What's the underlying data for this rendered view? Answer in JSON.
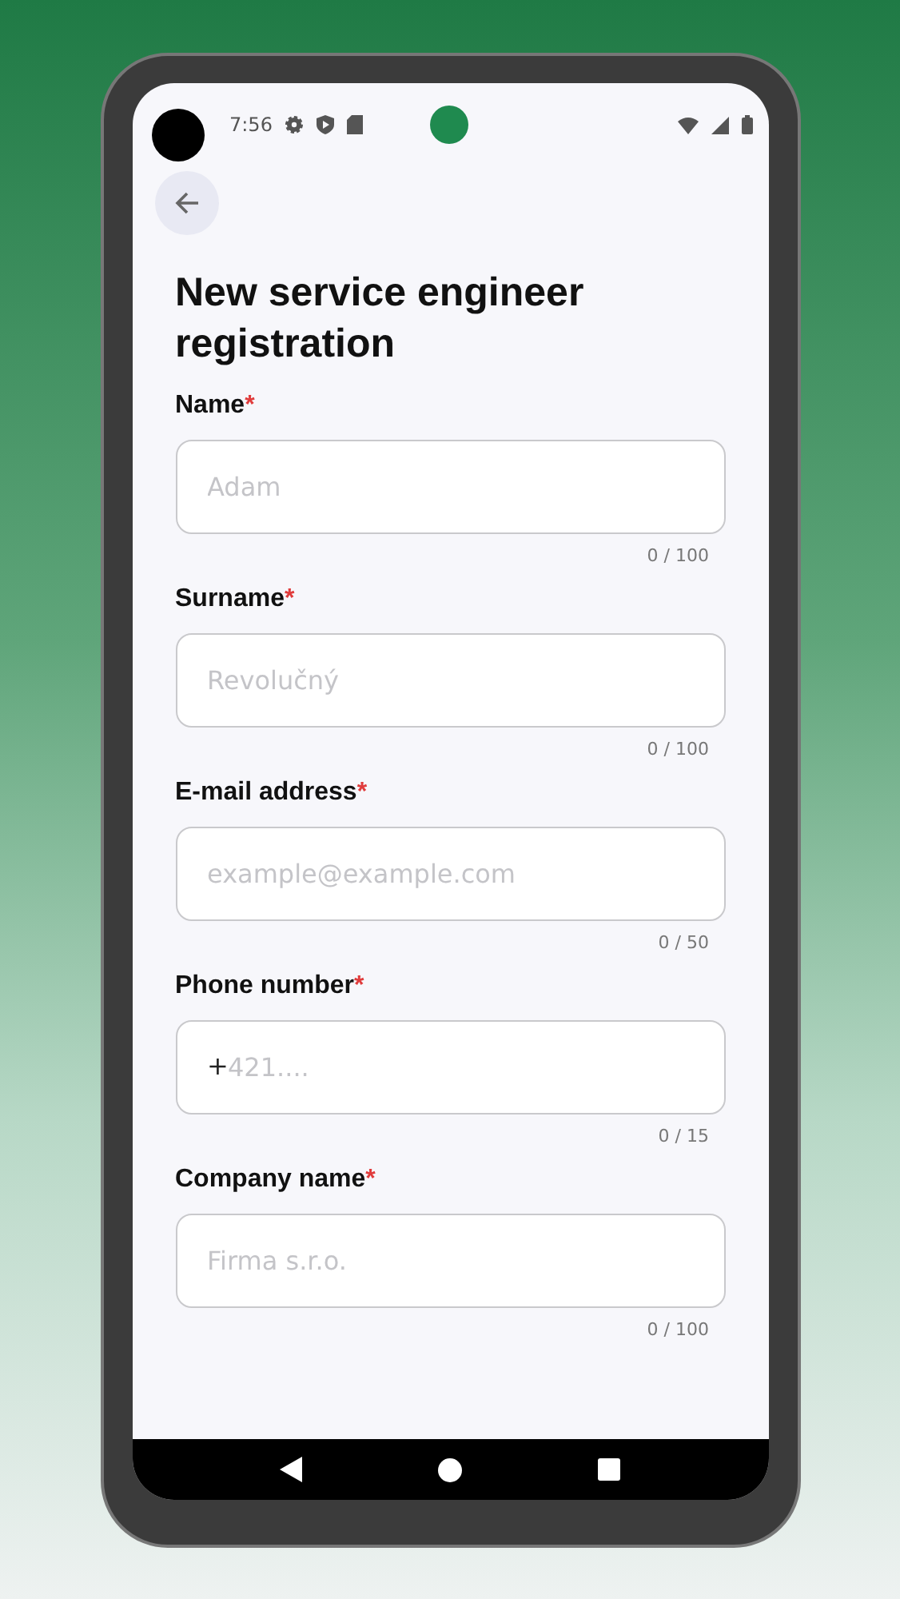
{
  "status_bar": {
    "time": "7:56"
  },
  "title": "New service engineer registration",
  "fields": [
    {
      "label": "Name",
      "mark": "*",
      "placeholder": "Adam",
      "counter": "0 / 100"
    },
    {
      "label": "Surname",
      "mark": "*",
      "placeholder": "Revolučný",
      "counter": "0 / 100"
    },
    {
      "label": "E-mail address",
      "mark": "*",
      "placeholder": "example@example.com",
      "counter": "0 / 50"
    },
    {
      "label": "Phone number",
      "mark": "*",
      "prefix": "+",
      "placeholder": "421....",
      "counter": "0 / 15"
    },
    {
      "label": "Company name",
      "mark": "*",
      "placeholder": "Firma s.r.o.",
      "counter": "0 / 100"
    }
  ]
}
